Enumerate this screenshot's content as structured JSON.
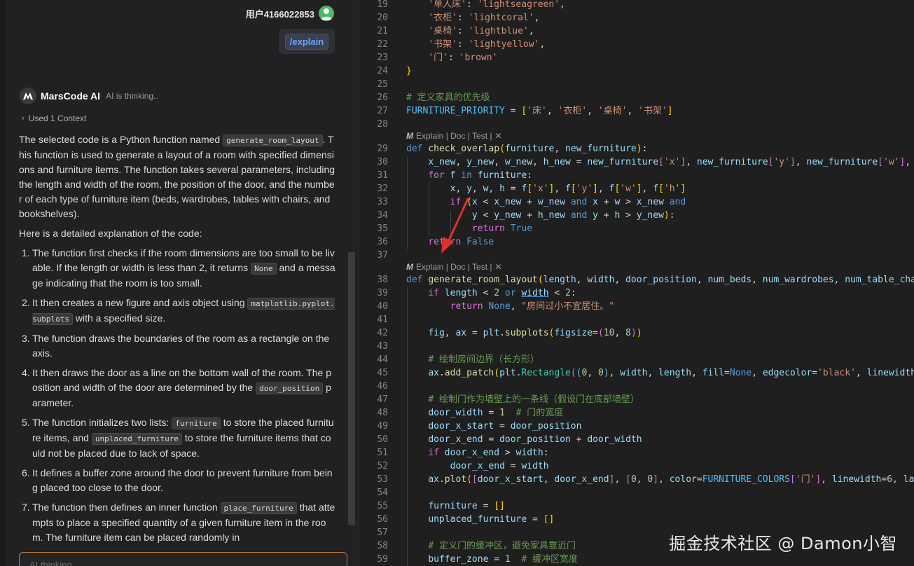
{
  "chat": {
    "user_name": "用户4166022853",
    "user_message": "/explain",
    "ai_name": "MarsCode AI",
    "ai_status": "AI is thinking..",
    "context_label": "Used 1 Context",
    "input_placeholder": "AI thinking..."
  },
  "answer": {
    "intro": {
      "a": "The selected code is a Python function named ",
      "code": "generate_room_layout",
      "b": ". This function is used to generate a layout of a room with specified dimensions and furniture items. The function takes several parameters, including the length and width of the room, the position of the door, and the number of each type of furniture item (beds, wardrobes, tables with chairs, and bookshelves)."
    },
    "detail_heading": "Here is a detailed explanation of the code:",
    "steps": [
      {
        "num": "1.",
        "a": "The function first checks if the room dimensions are too small to be livable. If the length or width is less than 2, it returns ",
        "code": "None",
        "b": " and a message indicating that the room is too small."
      },
      {
        "num": "2.",
        "a": "It then creates a new figure and axis object using ",
        "code": "matplotlib.pyplot.subplots",
        "b": " with a specified size."
      },
      {
        "num": "3.",
        "a": "The function draws the boundaries of the room as a rectangle on the axis.",
        "code": "",
        "b": ""
      },
      {
        "num": "4.",
        "a": "It then draws the door as a line on the bottom wall of the room. The position and width of the door are determined by the ",
        "code": "door_position",
        "b": " parameter."
      },
      {
        "num": "5.",
        "a": "The function initializes two lists: ",
        "code": "furniture",
        "b": " to store the placed furniture items, and ",
        "code2": "unplaced_furniture",
        "c": " to store the furniture items that could not be placed due to lack of space."
      },
      {
        "num": "6.",
        "a": "It defines a buffer zone around the door to prevent furniture from being placed too close to the door.",
        "code": "",
        "b": ""
      },
      {
        "num": "7.",
        "a": "The function then defines an inner function ",
        "code": "place_furniture",
        "b": " that attempts to place a specified quantity of a given furniture item in the room. The furniture item can be placed randomly in"
      }
    ]
  },
  "editor": {
    "lens_text": "Explain | Doc | Test |",
    "lens_close": "✕",
    "line_numbers": [
      "19",
      "20",
      "21",
      "22",
      "23",
      "24",
      "25",
      "26",
      "27",
      "28",
      "29",
      "30",
      "31",
      "32",
      "33",
      "34",
      "35",
      "36",
      "37",
      "38",
      "39",
      "40",
      "41",
      "42",
      "43",
      "44",
      "45",
      "46",
      "47",
      "48",
      "49",
      "50",
      "51",
      "52",
      "53",
      "54",
      "55",
      "56",
      "57",
      "58",
      "59"
    ]
  },
  "watermark": "掘金技术社区 @ Damon小智",
  "colors": {
    "accent_blue": "#6aa7ff",
    "avatar_green": "#4bb863",
    "input_border": "#c97c3d",
    "arrow_red": "#e03030"
  }
}
